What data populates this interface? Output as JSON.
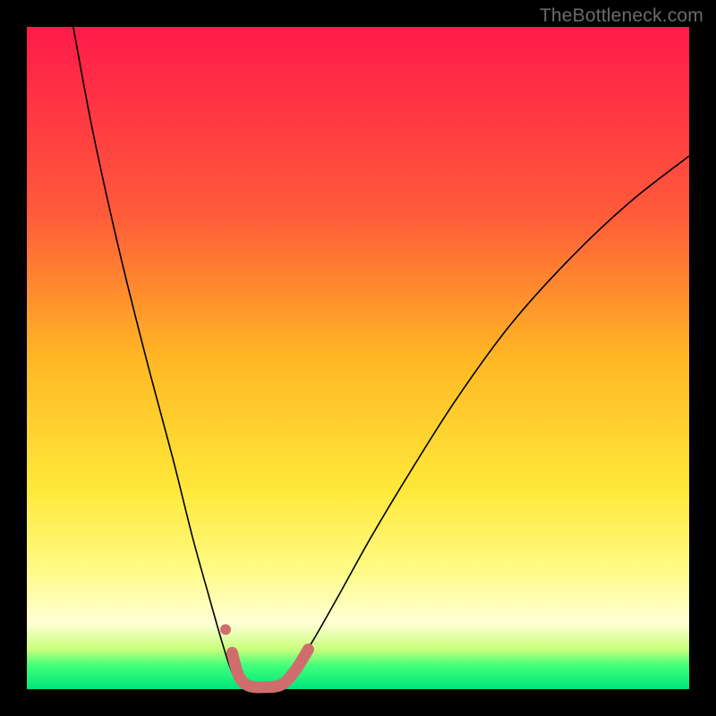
{
  "watermark": "TheBottleneck.com",
  "chart_data": {
    "type": "line",
    "title": "",
    "xlabel": "",
    "ylabel": "",
    "xlim": [
      0,
      100
    ],
    "ylim": [
      0,
      100
    ],
    "grid": false,
    "legend": false,
    "gradient_stops": [
      {
        "offset": 0.0,
        "color": "#ff1a4b"
      },
      {
        "offset": 0.28,
        "color": "#ff5a3a"
      },
      {
        "offset": 0.5,
        "color": "#ffb724"
      },
      {
        "offset": 0.7,
        "color": "#ffe93a"
      },
      {
        "offset": 0.82,
        "color": "#fffb86"
      },
      {
        "offset": 0.9,
        "color": "#ffffd6"
      },
      {
        "offset": 0.94,
        "color": "#c8ff7a"
      },
      {
        "offset": 0.965,
        "color": "#3fff7a"
      },
      {
        "offset": 1.0,
        "color": "#00e57a"
      }
    ],
    "series": [
      {
        "name": "bottleneck-curve",
        "color": "#000000",
        "stroke_width": 1.6,
        "points": [
          {
            "x": 7.0,
            "y": 100.0
          },
          {
            "x": 10.0,
            "y": 84.0
          },
          {
            "x": 14.0,
            "y": 66.0
          },
          {
            "x": 18.0,
            "y": 50.0
          },
          {
            "x": 22.0,
            "y": 35.0
          },
          {
            "x": 25.0,
            "y": 23.0
          },
          {
            "x": 27.5,
            "y": 14.0
          },
          {
            "x": 29.5,
            "y": 7.0
          },
          {
            "x": 31.0,
            "y": 2.5
          },
          {
            "x": 32.5,
            "y": 0.5
          },
          {
            "x": 34.0,
            "y": 0.0
          },
          {
            "x": 36.0,
            "y": 0.0
          },
          {
            "x": 38.0,
            "y": 0.5
          },
          {
            "x": 40.0,
            "y": 2.5
          },
          {
            "x": 43.0,
            "y": 7.0
          },
          {
            "x": 47.0,
            "y": 14.0
          },
          {
            "x": 52.0,
            "y": 23.0
          },
          {
            "x": 58.0,
            "y": 33.0
          },
          {
            "x": 65.0,
            "y": 44.0
          },
          {
            "x": 73.0,
            "y": 55.0
          },
          {
            "x": 82.0,
            "y": 65.0
          },
          {
            "x": 91.0,
            "y": 73.5
          },
          {
            "x": 100.0,
            "y": 80.5
          }
        ]
      },
      {
        "name": "highlight-segment",
        "color": "#cf6d6d",
        "stroke_width": 13,
        "linecap": "round",
        "points": [
          {
            "x": 31.0,
            "y": 5.5
          },
          {
            "x": 32.0,
            "y": 2.0
          },
          {
            "x": 33.5,
            "y": 0.5
          },
          {
            "x": 36.0,
            "y": 0.3
          },
          {
            "x": 38.5,
            "y": 0.7
          },
          {
            "x": 40.5,
            "y": 2.8
          },
          {
            "x": 42.5,
            "y": 6.0
          }
        ]
      },
      {
        "name": "highlight-dot",
        "color": "#cf6d6d",
        "type_hint": "scatter",
        "radius": 6,
        "points": [
          {
            "x": 30.0,
            "y": 9.0
          }
        ]
      }
    ]
  }
}
